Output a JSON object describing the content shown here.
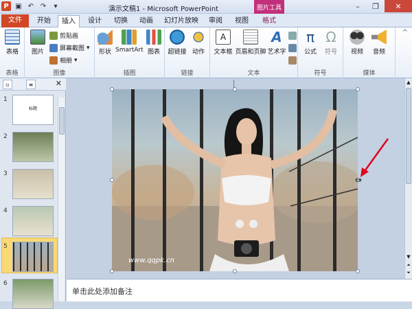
{
  "title_bar": {
    "window_title": "演示文稿1 - Microsoft PowerPoint",
    "context_tab": "图片工具"
  },
  "tabs": [
    "文件",
    "开始",
    "插入",
    "设计",
    "切换",
    "动画",
    "幻灯片放映",
    "审阅",
    "视图",
    "格式"
  ],
  "ribbon": {
    "groups": {
      "tables": "表格",
      "images": "图像",
      "illustrations": "插图",
      "links": "链接",
      "text": "文本",
      "symbols": "符号",
      "media": "媒体"
    },
    "table": "表格",
    "picture": "图片",
    "clip_art": "剪贴画",
    "screenshot": "屏幕截图",
    "album": "相册",
    "shapes": "形状",
    "smartart": "SmartArt",
    "chart": "图表",
    "hyperlink": "超链接",
    "action": "动作",
    "textbox": "文本框",
    "header_footer": "页眉和页脚",
    "wordart": "艺术字",
    "equation": "公式",
    "symbol": "符号",
    "video": "视频",
    "audio": "音频"
  },
  "slides": [
    "1",
    "2",
    "3",
    "4",
    "5",
    "6"
  ],
  "slide1_text": "标题",
  "watermark": "www.qqpk.cn",
  "notes_placeholder": "单击此处添加备注",
  "colors": {
    "file_tab": "#d24726",
    "context_tab": "#c22f7a",
    "selection": "#fbd975",
    "arrow": "#e0001b"
  }
}
